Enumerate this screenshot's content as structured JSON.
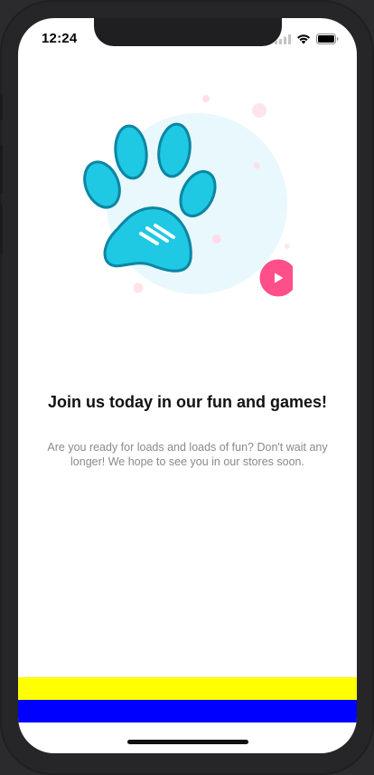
{
  "status_bar": {
    "time": "12:24",
    "icons": [
      "signal-icon",
      "wifi-icon",
      "battery-icon"
    ]
  },
  "hero": {
    "icon": "paw-print-icon",
    "action_icon": "play-icon"
  },
  "content": {
    "title": "Join us today in our fun and games!",
    "description": "Are you ready for loads and loads of fun? Don't wait any longer! We hope to see you in our stores soon."
  },
  "colors": {
    "accent": "#ff4f8b",
    "paw": "#1fc8e3",
    "paw_outline": "#0b86a3",
    "circle_bg": "#e9f8fc",
    "stripe_top": "#ffff00",
    "stripe_bottom": "#0000ff"
  }
}
